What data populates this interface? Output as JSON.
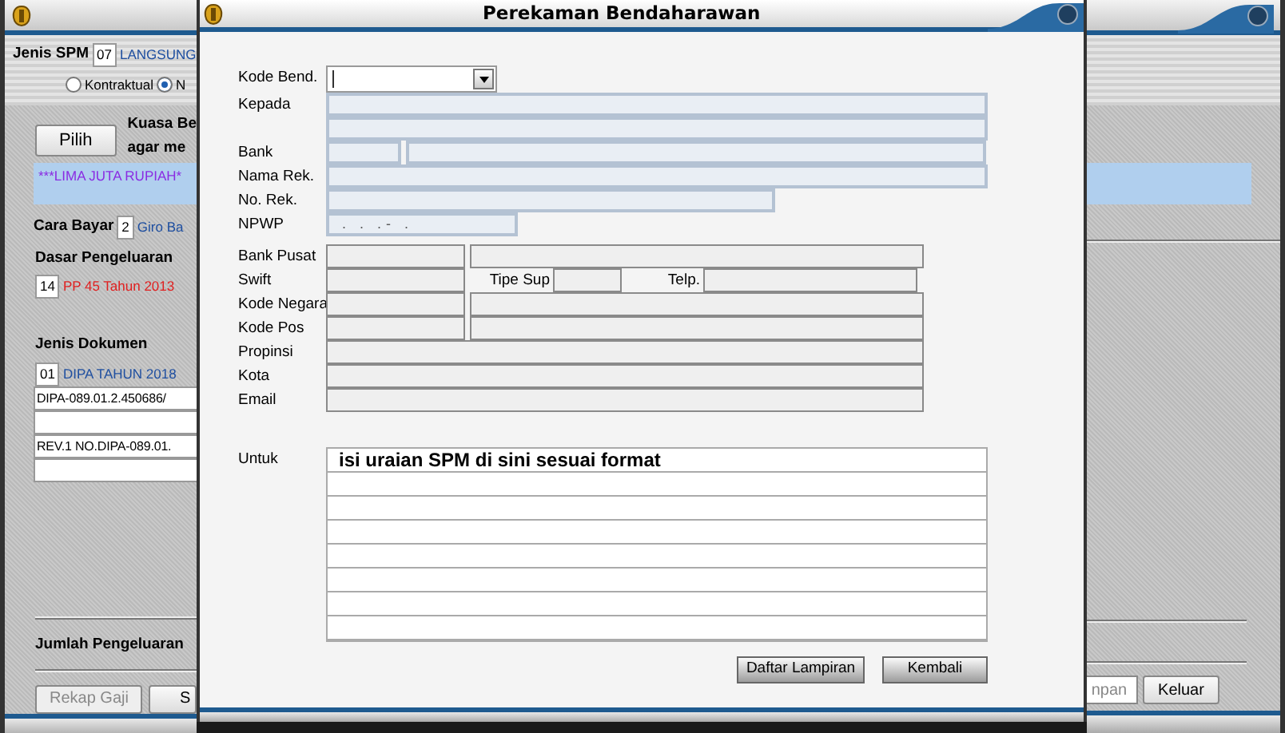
{
  "background_window": {
    "spm": {
      "label": "Jenis SPM",
      "code": "07",
      "type": "LANGSUNG"
    },
    "radios": [
      {
        "label": "Kontraktual",
        "selected": false
      },
      {
        "label": "N",
        "selected": true
      }
    ],
    "kuasa_lines": [
      "Kuasa Be",
      "agar me"
    ],
    "pilih_button": "Pilih",
    "amount_words": "***LIMA JUTA RUPIAH*",
    "cara_bayar": {
      "label": "Cara Bayar",
      "code": "2",
      "value": "Giro Ba"
    },
    "dasar": {
      "label": "Dasar Pengeluaran",
      "code": "14",
      "value": "PP 45 Tahun 2013"
    },
    "jenis_dokumen": {
      "label": "Jenis Dokumen",
      "code": "01",
      "value": "DIPA TAHUN 2018",
      "lines": [
        "DIPA-089.01.2.450686/",
        "REV.1 NO.DIPA-089.01."
      ]
    },
    "jumlah_label": "Jumlah Pengeluaran",
    "left_buttons": [
      {
        "label": "Rekap Gaji",
        "disabled": true
      },
      {
        "label": "S",
        "disabled": false
      }
    ],
    "right_buttons": [
      {
        "label": "npan",
        "disabled": true
      },
      {
        "label": "Keluar",
        "disabled": false
      }
    ]
  },
  "dialog": {
    "title": "Perekaman Bendaharawan",
    "rows": [
      {
        "kind": "combo",
        "label": "Kode Bend."
      },
      {
        "kind": "blue_full",
        "label": "Kepada"
      },
      {
        "kind": "blue_full"
      },
      {
        "kind": "blue_split",
        "label": "Bank"
      },
      {
        "kind": "blue_full",
        "label": "Nama Rek."
      },
      {
        "kind": "blue_wide",
        "label": "No. Rek."
      },
      {
        "kind": "blue_short",
        "label": "NPWP",
        "value": ". . .- ."
      },
      {
        "kind": "grey_split",
        "label": "Bank Pusat"
      },
      {
        "kind": "grey_swift",
        "label": "Swift",
        "tipe_label": "Tipe Sup",
        "telp_label": "Telp."
      },
      {
        "kind": "grey_split",
        "label": "Kode Negara"
      },
      {
        "kind": "grey_split",
        "label": "Kode Pos"
      },
      {
        "kind": "grey_full",
        "label": "Propinsi"
      },
      {
        "kind": "grey_full",
        "label": "Kota"
      },
      {
        "kind": "grey_full",
        "label": "Email"
      }
    ],
    "untuk": {
      "label": "Untuk",
      "text": "isi uraian SPM di sini sesuai format"
    },
    "buttons": [
      "Daftar Lampiran",
      "Kembali"
    ]
  }
}
